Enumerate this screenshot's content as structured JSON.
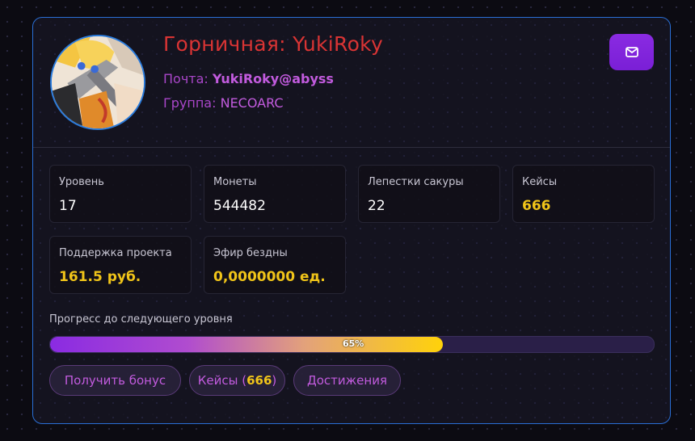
{
  "profile": {
    "title": "Горничная: YukiRoky",
    "email_label": "Почта:",
    "email": "YukiRoky@abyss",
    "group_label": "Группа:",
    "group": "NECOARC"
  },
  "header": {
    "mail_button_icon": "envelope-icon"
  },
  "stats": [
    {
      "label": "Уровень",
      "value": "17"
    },
    {
      "label": "Монеты",
      "value": "544482"
    },
    {
      "label": "Лепестки сакуры",
      "value": "22"
    },
    {
      "label": "Кейсы",
      "value": "666"
    },
    {
      "label": "Поддержка проекта",
      "value": "161.5 руб."
    },
    {
      "label": "Эфир бездны",
      "value": "0,0000000 ед."
    }
  ],
  "progress": {
    "label": "Прогресс до следующего уровня",
    "percent": 65,
    "text": "65%"
  },
  "actions": {
    "bonus": "Получить бонус",
    "cases_prefix": "Кейсы (",
    "cases_count": "666",
    "cases_suffix": ")",
    "achievements": "Достижения"
  },
  "colors": {
    "accent": "#8a2be2",
    "title": "#d93434",
    "gold": "#f0c419",
    "border": "#2a6fd6"
  }
}
